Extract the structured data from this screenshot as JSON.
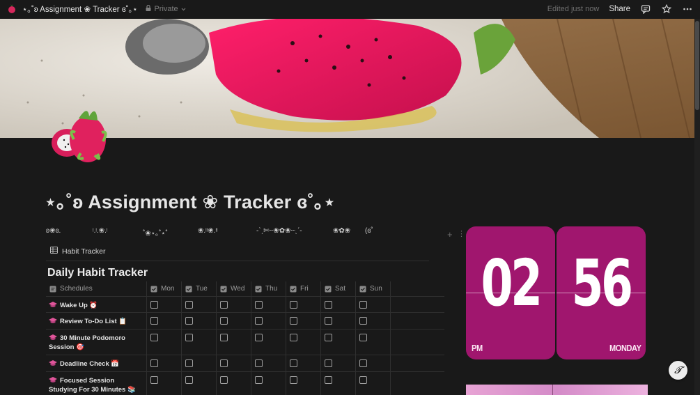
{
  "topbar": {
    "page_title": "⋆｡˚ʚ Assignment ❀ Tracker ɞ˚｡⋆",
    "privacy": "Private",
    "edited": "Edited just now",
    "share": "Share",
    "icons": [
      "dragon-fruit-icon",
      "lock-icon",
      "chevron-down-icon",
      "comment-icon",
      "star-icon",
      "more-icon"
    ]
  },
  "page": {
    "title": "⋆｡˚ʚ  Assignment ❀ Tracker  ɞ˚｡⋆"
  },
  "decorations": [
    "ʚ❀ɞ.",
    "ᵎ.ᵎ.❀.ᵎ",
    "˚❀⋆｡˚⋆˚",
    "❀.ᵎᵎ❀.ᵎᵎ",
    "-ˋˏ✄┈❀✿❀┈ˎˊ-",
    "❀✿❀",
    "(ɞ˚"
  ],
  "view": {
    "tab_label": "Habit Tracker",
    "db_title": "Daily Habit Tracker"
  },
  "table": {
    "name_header": "Schedules",
    "days": [
      "Mon",
      "Tue",
      "Wed",
      "Thu",
      "Fri",
      "Sat",
      "Sun"
    ],
    "rows": [
      {
        "name": "Wake Up ⏰"
      },
      {
        "name": "Review To-Do List 📋"
      },
      {
        "name": "30 Minute Podomoro Session 🎯"
      },
      {
        "name": "Deadline Check 📅"
      },
      {
        "name": "Focused Session Studying For 30 Minutes 📚"
      }
    ]
  },
  "clock": {
    "hours": "02",
    "minutes": "56",
    "period": "PM",
    "day": "MONDAY"
  },
  "colors": {
    "background": "#191919",
    "clock_card": "#a0166e",
    "text": "#d4d4d4"
  }
}
